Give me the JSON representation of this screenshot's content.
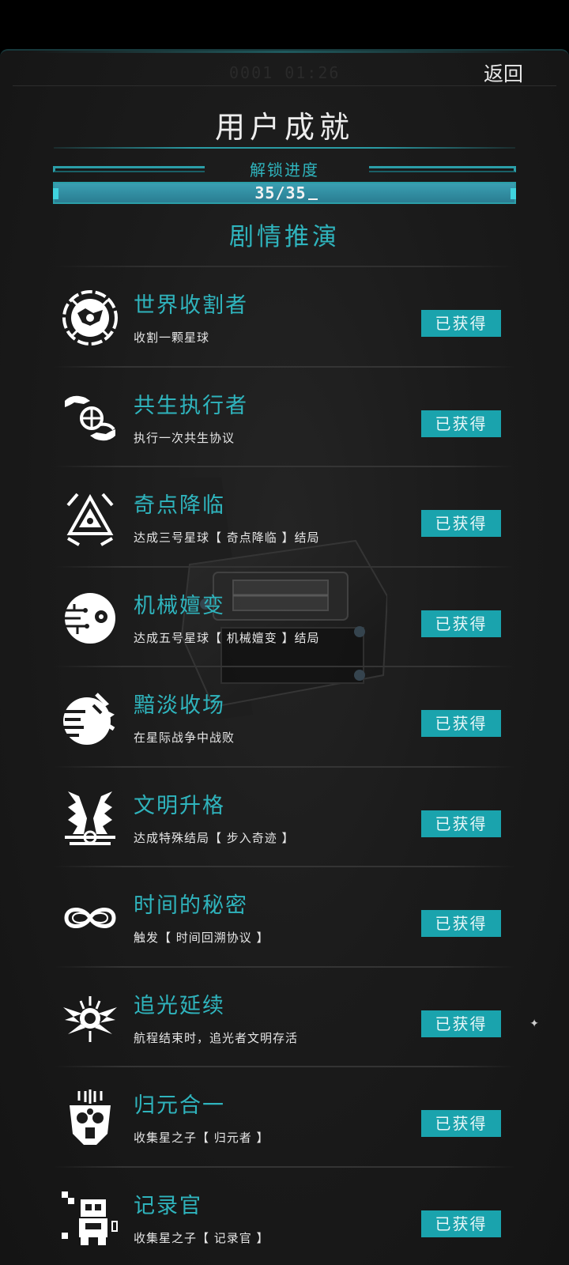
{
  "header": {
    "timer": "0001 01:26",
    "back_label": "返回",
    "title": "用户成就"
  },
  "progress": {
    "label": "解锁进度",
    "value_text": "35/35",
    "unlocked": 35,
    "total": 35,
    "fraction": 1.0
  },
  "section": {
    "title": "剧情推演"
  },
  "colors": {
    "accent": "#2fb4bd",
    "badge": "#1aa3ad",
    "background": "#1b1b1b"
  },
  "achievements": [
    {
      "title": "世界收割者",
      "desc": "收割一颗星球",
      "badge": "已获得",
      "icon": "harvested-planet-icon"
    },
    {
      "title": "共生执行者",
      "desc": "执行一次共生协议",
      "badge": "已获得",
      "icon": "hands-globe-icon"
    },
    {
      "title": "奇点降临",
      "desc": "达成三号星球【 奇点降临 】结局",
      "badge": "已获得",
      "icon": "singularity-triangle-icon"
    },
    {
      "title": "机械嬗变",
      "desc": "达成五号星球【 机械嬗变 】结局",
      "badge": "已获得",
      "icon": "cyber-eye-icon"
    },
    {
      "title": "黯淡收场",
      "desc": "在星际战争中战败",
      "badge": "已获得",
      "icon": "fading-planet-icon"
    },
    {
      "title": "文明升格",
      "desc": "达成特殊结局【 步入奇迹 】",
      "badge": "已获得",
      "icon": "winged-emblem-icon"
    },
    {
      "title": "时间的秘密",
      "desc": "触发【 时间回溯协议 】",
      "badge": "已获得",
      "icon": "infinity-icon"
    },
    {
      "title": "追光延续",
      "desc": "航程结束时，追光者文明存活",
      "badge": "已获得",
      "icon": "winged-sun-icon"
    },
    {
      "title": "归元合一",
      "desc": "收集星之子【 归元者 】",
      "badge": "已获得",
      "icon": "circuit-mask-icon"
    },
    {
      "title": "记录官",
      "desc": "收集星之子【 记录官 】",
      "badge": "已获得",
      "icon": "pixel-robot-icon"
    }
  ]
}
